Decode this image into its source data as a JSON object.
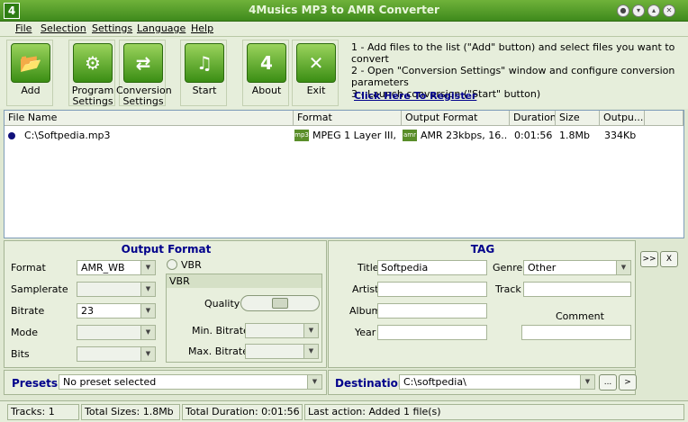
{
  "window": {
    "title": "4Musics MP3 to AMR Converter",
    "app_icon": "4"
  },
  "menu": [
    "File",
    "Selection",
    "Settings",
    "Language",
    "Help"
  ],
  "toolbar": {
    "add": "Add",
    "program_settings": "Program Settings",
    "conversion_settings": "Conversion Settings",
    "start": "Start",
    "about": "About",
    "exit": "Exit"
  },
  "instructions": [
    "1 - Add files to the list (\"Add\" button) and select files you want to convert",
    "2 - Open \"Conversion Settings\" window and configure conversion parameters",
    "3 - Launch conversion (\"Start\" button)"
  ],
  "register_link": "Click Here To Register",
  "file_list": {
    "columns": [
      "File Name",
      "Format",
      "Output Format",
      "Duration",
      "Size",
      "Outpu..."
    ],
    "rows": [
      {
        "file": "C:\\Softpedia.mp3",
        "format_icon": "mp3",
        "format": "MPEG 1 Layer III, ...",
        "out_icon": "amr",
        "output_format": "AMR 23kbps, 16...",
        "duration": "0:01:56",
        "size": "1.8Mb",
        "output": "334Kb"
      }
    ]
  },
  "output_format": {
    "title": "Output Format",
    "labels": {
      "format": "Format",
      "samplerate": "Samplerate",
      "bitrate": "Bitrate",
      "mode": "Mode",
      "bits": "Bits"
    },
    "values": {
      "format": "AMR_WB",
      "samplerate": "",
      "bitrate": "23",
      "mode": "",
      "bits": ""
    },
    "vbr_checkbox": "VBR",
    "vbr_group": {
      "title": "VBR",
      "quality": "Quality",
      "min_bitrate": "Min. Bitrate",
      "max_bitrate": "Max. Bitrate",
      "quality_level": 0.5
    }
  },
  "tag": {
    "title": "TAG",
    "labels": {
      "title": "Title",
      "artist": "Artist",
      "album": "Album",
      "year": "Year",
      "genre": "Genre",
      "track": "Track",
      "comment": "Comment"
    },
    "values": {
      "title": "Softpedia",
      "artist": "",
      "album": "",
      "year": "",
      "genre": "Other",
      "track": "",
      "comment": ""
    }
  },
  "side_buttons": {
    "expand": ">>",
    "close": "X"
  },
  "presets": {
    "label": "Presets",
    "value": "No preset selected"
  },
  "destination": {
    "label": "Destination",
    "value": "C:\\softpedia\\",
    "browse": "...",
    "go": ">"
  },
  "status": {
    "tracks": "Tracks: 1",
    "sizes": "Total Sizes: 1.8Mb",
    "duration": "Total Duration: 0:01:56",
    "last_action": "Last action: Added 1 file(s)"
  }
}
